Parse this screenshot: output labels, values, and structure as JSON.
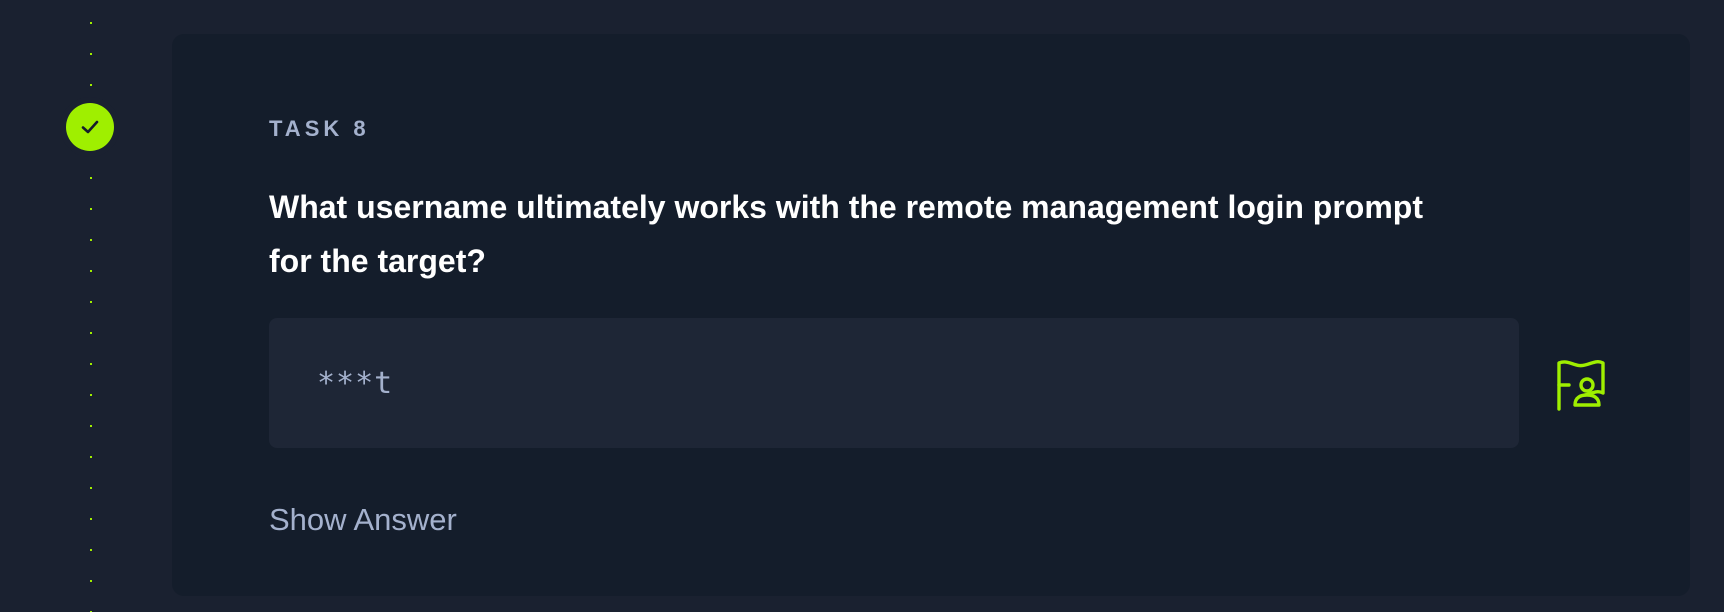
{
  "task": {
    "label": "TASK 8",
    "question": "What username ultimately works with the remote management login prompt for the target?",
    "answer_masked": "***t",
    "show_answer_label": "Show Answer",
    "status": "completed"
  },
  "icons": {
    "status": "check-icon",
    "submit": "flag-user-icon"
  },
  "colors": {
    "accent": "#9fef00",
    "background": "#1a2130",
    "card": "#141d2b",
    "input": "#1e2636",
    "muted_text": "#a4b1cd",
    "text": "#ffffff"
  }
}
